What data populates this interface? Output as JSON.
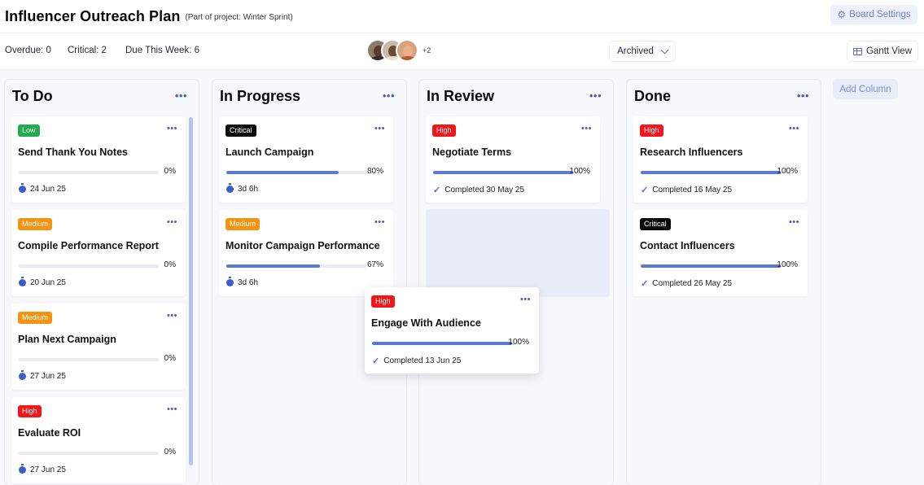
{
  "header": {
    "title": "Influencer Outreach Plan",
    "subtitle": "(Part of project: Winter Sprint)",
    "board_settings_label": "Board Settings",
    "board_settings_icon": "gear-icon"
  },
  "toolbar": {
    "overdue": "Overdue: 0",
    "critical": "Critical: 2",
    "due_this_week": "Due This Week: 6",
    "avatars_more": "+2",
    "archived_label": "Archived",
    "gantt_label": "Gantt View"
  },
  "priority_colors": {
    "Low": "#1fae4d",
    "Medium": "#f59311",
    "High": "#f2161b",
    "Critical": "#0a0a0a"
  },
  "progress_color": "#5b79d6",
  "columns": [
    {
      "title": "To Do",
      "menu": "···",
      "cards": [
        {
          "priority": "Low",
          "title": "Send Thank You Notes",
          "progress": "0%",
          "due": "24 Jun 25"
        },
        {
          "priority": "Medium",
          "title": "Compile Performance Report",
          "progress": "0%",
          "due": "20 Jun 25"
        },
        {
          "priority": "Medium",
          "title": "Plan Next Campaign",
          "progress": "0%",
          "due": "27 Jun 25"
        },
        {
          "priority": "High",
          "title": "Evaluate ROI",
          "progress": "0%",
          "due": "27 Jun 25"
        }
      ]
    },
    {
      "title": "In Progress",
      "menu": "···",
      "cards": [
        {
          "priority": "Critical",
          "title": "Launch Campaign",
          "progress": "80%",
          "due": "3d 6h"
        },
        {
          "priority": "Medium",
          "title": "Monitor Campaign Performance",
          "progress": "67%",
          "due": "3d 6h"
        }
      ]
    },
    {
      "title": "In Review",
      "menu": "···",
      "cards": [
        {
          "priority": "High",
          "title": "Negotiate Terms",
          "progress": "100%",
          "due": "Completed 30 May 25"
        }
      ]
    },
    {
      "title": "Done",
      "menu": "···",
      "cards": [
        {
          "priority": "High",
          "title": "Research Influencers",
          "progress": "100%",
          "due": "Completed 16 May 25"
        },
        {
          "priority": "Critical",
          "title": "Contact Influencers",
          "progress": "100%",
          "due": "Completed 26 May 25"
        }
      ]
    }
  ],
  "dragging_card": {
    "priority": "High",
    "title": "Engage With Audience",
    "progress": "100%",
    "due": "Completed 13 Jun 25"
  },
  "add_column_label": "Add Column"
}
